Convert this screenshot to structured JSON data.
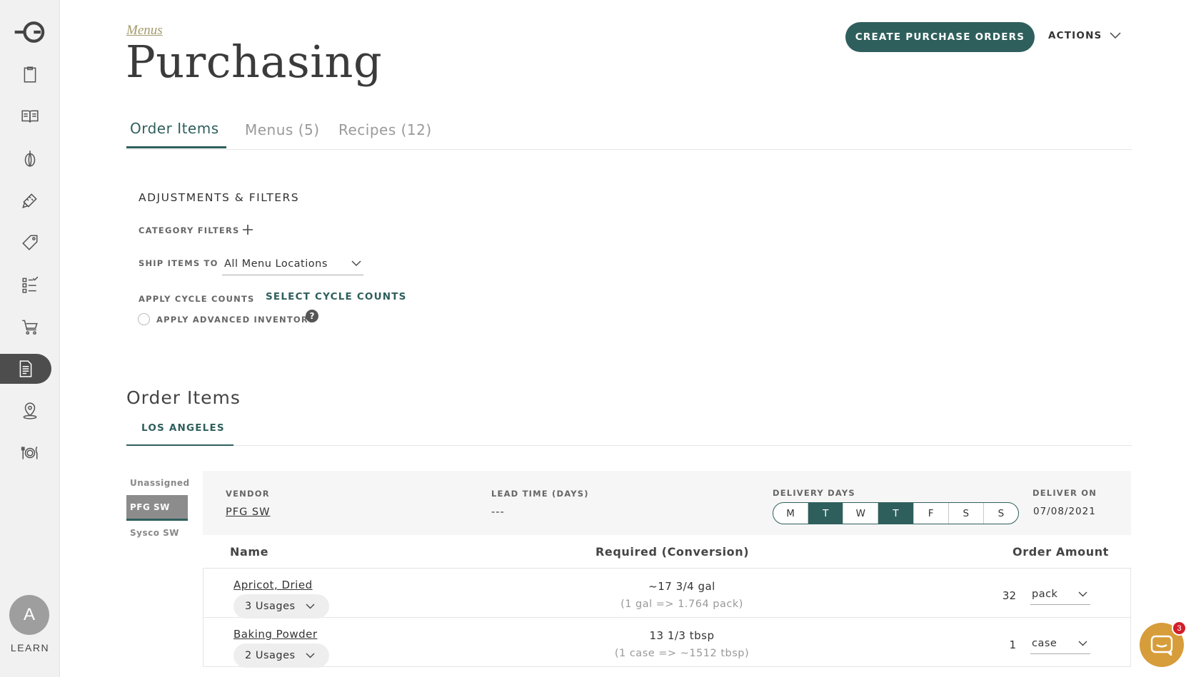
{
  "sidebar": {
    "icons": [
      "logo-key-g-icon",
      "clipboard-icon",
      "book-icon",
      "onion-icon",
      "ruler-pencil-icon",
      "price-tag-icon",
      "checklist-icon",
      "cart-icon",
      "document-icon",
      "location-pin-icon",
      "plate-cutlery-icon"
    ],
    "active_icon": "document-icon",
    "avatar_initial": "A",
    "learn_label": "LEARN"
  },
  "header": {
    "breadcrumb": "Menus",
    "title": "Purchasing",
    "create_button": "CREATE PURCHASE ORDERS",
    "actions_label": "ACTIONS"
  },
  "tabs": [
    {
      "label": "Order Items",
      "active": true
    },
    {
      "label": "Menus (5)",
      "active": false
    },
    {
      "label": "Recipes (12)",
      "active": false
    }
  ],
  "filters": {
    "title": "ADJUSTMENTS & FILTERS",
    "category_label": "CATEGORY FILTERS",
    "ship_label": "SHIP ITEMS TO",
    "ship_value": "All Menu Locations",
    "cycle_label": "APPLY CYCLE COUNTS",
    "cycle_link": "SELECT CYCLE COUNTS",
    "advanced_label": "APPLY ADVANCED INVENTORY",
    "help_glyph": "?"
  },
  "order_items": {
    "title": "Order Items",
    "location_tab": "LOS ANGELES",
    "vendors": [
      "Unassigned",
      "PFG SW",
      "Sysco SW"
    ],
    "active_vendor": "PFG SW",
    "vendor_panel": {
      "vendor_label": "VENDOR",
      "vendor_value": "PFG SW",
      "lead_label": "LEAD TIME (DAYS)",
      "lead_value": "---",
      "delivery_label": "DELIVERY DAYS",
      "days": [
        {
          "d": "M",
          "on": false
        },
        {
          "d": "T",
          "on": true
        },
        {
          "d": "W",
          "on": false
        },
        {
          "d": "T",
          "on": true
        },
        {
          "d": "F",
          "on": false
        },
        {
          "d": "S",
          "on": false
        },
        {
          "d": "S",
          "on": false
        }
      ],
      "deliver_label": "DELIVER ON",
      "deliver_value": "07/08/2021"
    },
    "columns": {
      "name": "Name",
      "required": "Required (Conversion)",
      "amount": "Order Amount"
    },
    "rows": [
      {
        "name": "Apricot, Dried",
        "usages": "3 Usages",
        "required": "~17 3/4 gal",
        "conversion": "(1 gal => 1.764 pack)",
        "amount": "32",
        "unit": "pack"
      },
      {
        "name": "Baking Powder",
        "usages": "2 Usages",
        "required": "13 1/3 tbsp",
        "conversion": "(1 case => ~1512 tbsp)",
        "amount": "1",
        "unit": "case"
      }
    ]
  },
  "chat": {
    "badge": "3"
  }
}
